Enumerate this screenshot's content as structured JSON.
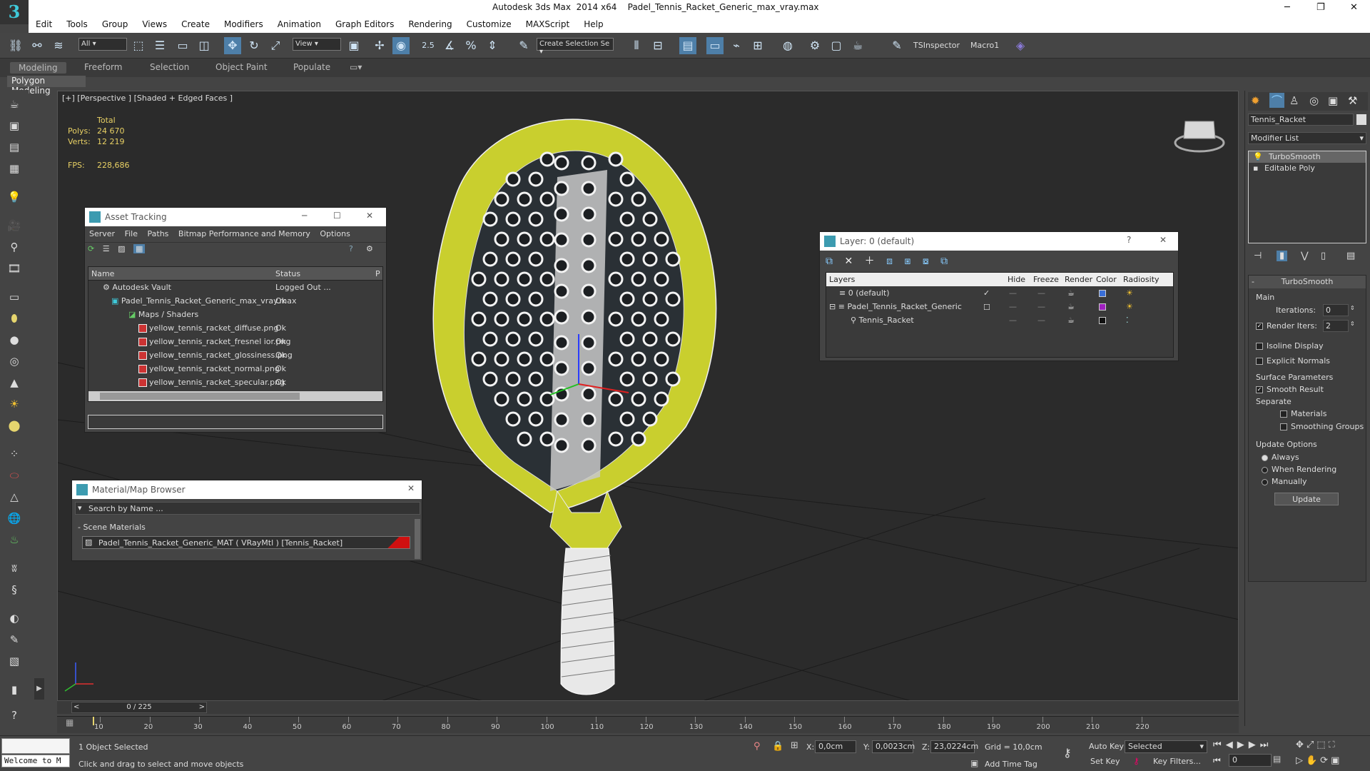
{
  "window": {
    "title": "Autodesk 3ds Max  2014 x64    Padel_Tennis_Racket_Generic_max_vray.max",
    "minimize": "─",
    "restore": "❐",
    "close": "✕",
    "logo": "3"
  },
  "menu": [
    "Edit",
    "Tools",
    "Group",
    "Views",
    "Create",
    "Modifiers",
    "Animation",
    "Graph Editors",
    "Rendering",
    "Customize",
    "MAXScript",
    "Help"
  ],
  "toolbar": {
    "filter": "All",
    "refcoord": "View",
    "angle_snap": "2.5",
    "selection_set": "Create Selection Se",
    "tsinspector": "TSInspector",
    "macro1": "Macro1"
  },
  "ribbon": {
    "tabs": [
      "Modeling",
      "Freeform",
      "Selection",
      "Object Paint",
      "Populate"
    ],
    "sub": "Polygon Modeling"
  },
  "viewport": {
    "label": "[+] [Perspective ] [Shaded + Edged Faces ]",
    "stats": {
      "total": "Total",
      "polys_label": "Polys:",
      "polys": "24 670",
      "verts_label": "Verts:",
      "verts": "12 219",
      "fps_label": "FPS:",
      "fps": "228,686"
    }
  },
  "asset_tracking": {
    "title": "Asset Tracking",
    "menu": [
      "Server",
      "File",
      "Paths",
      "Bitmap Performance and Memory",
      "Options"
    ],
    "columns": [
      "Name",
      "Status",
      "P"
    ],
    "rows": [
      {
        "name": "Autodesk Vault",
        "status": "Logged Out ..."
      },
      {
        "name": "Padel_Tennis_Racket_Generic_max_vray.max",
        "status": "Ok"
      },
      {
        "name": "Maps / Shaders",
        "status": ""
      },
      {
        "name": "yellow_tennis_racket_diffuse.png",
        "status": "Ok"
      },
      {
        "name": "yellow_tennis_racket_fresnel ior.png",
        "status": "Ok"
      },
      {
        "name": "yellow_tennis_racket_glossiness.png",
        "status": "Ok"
      },
      {
        "name": "yellow_tennis_racket_normal.png",
        "status": "Ok"
      },
      {
        "name": "yellow_tennis_racket_specular.png",
        "status": "Ok"
      }
    ]
  },
  "material_browser": {
    "title": "Material/Map Browser",
    "search": "Search by Name ...",
    "section": "- Scene Materials",
    "item": "Padel_Tennis_Racket_Generic_MAT  ( VRayMtl )  [Tennis_Racket]"
  },
  "layer_dialog": {
    "title": "Layer: 0 (default)",
    "help": "?",
    "columns": [
      "Layers",
      "Hide",
      "Freeze",
      "Render",
      "Color",
      "Radiosity"
    ],
    "rows": [
      {
        "name": "0 (default)",
        "color": "#3a6fd8"
      },
      {
        "name": "Padel_Tennis_Racket_Generic",
        "color": "#a020c0"
      },
      {
        "name": "Tennis_Racket",
        "color": "#111111"
      }
    ]
  },
  "command_panel": {
    "object_name": "Tennis_Racket",
    "modifier_list": "Modifier List",
    "stack": [
      "TurboSmooth",
      "Editable Poly"
    ],
    "rollout": "TurboSmooth",
    "main": "Main",
    "iterations_label": "Iterations:",
    "iterations": "0",
    "render_iters_label": "Render Iters:",
    "render_iters": "2",
    "isoline": "Isoline Display",
    "explicit_normals": "Explicit Normals",
    "surface_params": "Surface Parameters",
    "smooth_result": "Smooth Result",
    "separate": "Separate",
    "materials": "Materials",
    "smoothing_groups": "Smoothing Groups",
    "update_options": "Update Options",
    "always": "Always",
    "when_rendering": "When Rendering",
    "manually": "Manually",
    "update": "Update"
  },
  "timeline": {
    "frame": "0 / 225",
    "ticks": [
      "10",
      "20",
      "30",
      "40",
      "50",
      "60",
      "70",
      "80",
      "90",
      "100",
      "110",
      "120",
      "130",
      "140",
      "150",
      "160",
      "170",
      "180",
      "190",
      "200",
      "210",
      "220"
    ]
  },
  "status": {
    "maxscript": "Welcome to M",
    "selected": "1 Object Selected",
    "hint": "Click and drag to select and move objects",
    "x_label": "X:",
    "x": "0,0cm",
    "y_label": "Y:",
    "y": "0,0023cm",
    "z_label": "Z:",
    "z": "23,0224cm",
    "grid": "Grid = 10,0cm",
    "add_time_tag": "Add Time Tag",
    "auto_key": "Auto Key",
    "set_key": "Set Key",
    "selected_drop": "Selected",
    "key_filters": "Key Filters...",
    "frame": "0"
  }
}
